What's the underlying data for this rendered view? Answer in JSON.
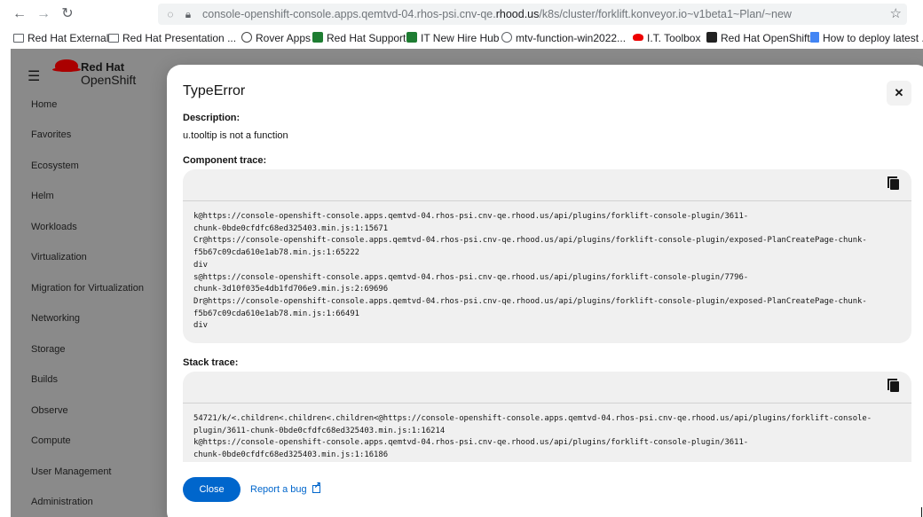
{
  "browser": {
    "url_prefix": "console-openshift-console.apps.qemtvd-04.rhos-psi.cnv-qe.",
    "url_domain": "rhood.us",
    "url_path": "/k8s/cluster/forklift.konveyor.io~v1beta1~Plan/~new",
    "back_glyph": "←",
    "forward_glyph": "→",
    "reload_glyph": "↻",
    "bookmarks": [
      {
        "label": "Red Hat External",
        "icon": "folder-icon"
      },
      {
        "label": "Red Hat Presentation ...",
        "icon": "folder-icon"
      },
      {
        "label": "Rover Apps",
        "icon": "globe-icon"
      },
      {
        "label": "Red Hat Support",
        "icon": "redhat-support-icon"
      },
      {
        "label": "IT New Hire Hub",
        "icon": "hub-icon"
      },
      {
        "label": "mtv-function-win2022...",
        "icon": "globe-icon"
      },
      {
        "label": "I.T. Toolbox",
        "icon": "redhat-hat-icon"
      },
      {
        "label": "Red Hat OpenShift",
        "icon": "openshift-icon"
      },
      {
        "label": "How to deploy latest ...",
        "icon": "doc-icon"
      }
    ]
  },
  "console": {
    "logo_line1": "Red Hat",
    "logo_line2": "OpenShift",
    "nav": [
      "Home",
      "Favorites",
      "Ecosystem",
      "Helm",
      "Workloads",
      "Virtualization",
      "Migration for Virtualization",
      "Networking",
      "Storage",
      "Builds",
      "Observe",
      "Compute",
      "User Management",
      "Administration"
    ]
  },
  "modal": {
    "title": "TypeError",
    "close_glyph": "✕",
    "description_label": "Description:",
    "description": "u.tooltip is not a function",
    "component_trace_label": "Component trace:",
    "component_trace": "k@https://console-openshift-console.apps.qemtvd-04.rhos-psi.cnv-qe.rhood.us/api/plugins/forklift-console-plugin/3611-\nchunk-0bde0cfdfc68ed325403.min.js:1:15671\nCr@https://console-openshift-console.apps.qemtvd-04.rhos-psi.cnv-qe.rhood.us/api/plugins/forklift-console-plugin/exposed-PlanCreatePage-chunk-\nf5b67c09cda610e1ab78.min.js:1:65222\ndiv\ns@https://console-openshift-console.apps.qemtvd-04.rhos-psi.cnv-qe.rhood.us/api/plugins/forklift-console-plugin/7796-\nchunk-3d10f035e4db1fd706e9.min.js:2:69696\nDr@https://console-openshift-console.apps.qemtvd-04.rhos-psi.cnv-qe.rhood.us/api/plugins/forklift-console-plugin/exposed-PlanCreatePage-chunk-\nf5b67c09cda610e1ab78.min.js:1:66491\ndiv",
    "stack_trace_label": "Stack trace:",
    "stack_trace": "54721/k/<.children<.children<.children<@https://console-openshift-console.apps.qemtvd-04.rhos-psi.cnv-qe.rhood.us/api/plugins/forklift-console-\nplugin/3611-chunk-0bde0cfdfc68ed325403.min.js:1:16214\nk@https://console-openshift-console.apps.qemtvd-04.rhos-psi.cnv-qe.rhood.us/api/plugins/forklift-console-plugin/3611-\nchunk-0bde0cfdfc68ed325403.min.js:1:16186",
    "close_button": "Close",
    "report_bug": "Report a bug"
  }
}
